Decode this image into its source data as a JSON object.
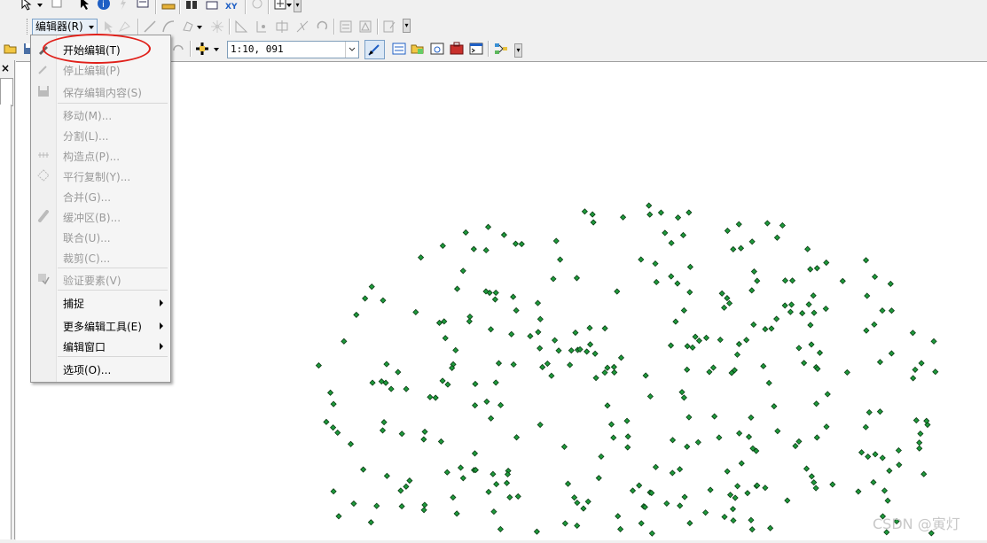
{
  "toolbar": {
    "editor_menu_label": "编辑器(R)",
    "scale": "1:10, 091"
  },
  "editor_menu": {
    "items": [
      {
        "label": "开始编辑(T)",
        "enabled": true,
        "submenu": false
      },
      {
        "label": "停止编辑(P)",
        "enabled": false,
        "submenu": false
      },
      {
        "label": "保存编辑内容(S)",
        "enabled": false,
        "submenu": false
      },
      {
        "label": "移动(M)...",
        "enabled": false,
        "submenu": false
      },
      {
        "label": "分割(L)...",
        "enabled": false,
        "submenu": false
      },
      {
        "label": "构造点(P)...",
        "enabled": false,
        "submenu": false
      },
      {
        "label": "平行复制(Y)...",
        "enabled": false,
        "submenu": false
      },
      {
        "label": "合并(G)...",
        "enabled": false,
        "submenu": false
      },
      {
        "label": "缓冲区(B)...",
        "enabled": false,
        "submenu": false
      },
      {
        "label": "联合(U)...",
        "enabled": false,
        "submenu": false
      },
      {
        "label": "裁剪(C)...",
        "enabled": false,
        "submenu": false
      },
      {
        "label": "验证要素(V)",
        "enabled": false,
        "submenu": false
      },
      {
        "label": "捕捉",
        "enabled": true,
        "submenu": true
      },
      {
        "label": "更多编辑工具(E)",
        "enabled": true,
        "submenu": true
      },
      {
        "label": "编辑窗口",
        "enabled": true,
        "submenu": true
      },
      {
        "label": "选项(O)...",
        "enabled": true,
        "submenu": false
      }
    ]
  },
  "left_pane": {
    "close_glyph": "×"
  },
  "watermark": "CSDN @寅灯",
  "colors": {
    "point_fill": "#1e9a3c",
    "point_stroke": "#0a3a12",
    "highlight": "#e0201a"
  }
}
